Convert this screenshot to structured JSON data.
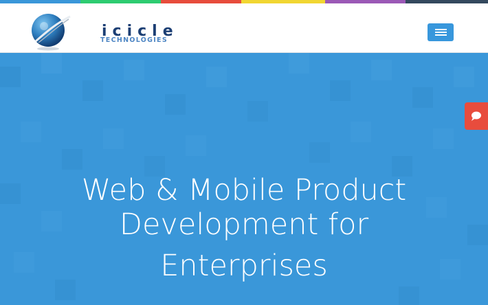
{
  "colorbar": {
    "segments": [
      "#3a97d9",
      "#2ecc71",
      "#e74c3c",
      "#f1d632",
      "#9b59b6",
      "#34495e"
    ]
  },
  "header": {
    "logo": {
      "name": "icicle",
      "tagline": "TECHNOLOGIES",
      "icon": "globe-swoosh-logo"
    },
    "menu_button": {
      "icon": "hamburger-menu-icon"
    }
  },
  "hero": {
    "title_lines": [
      "Web & Mobile Product",
      "Development for",
      "Enterprises"
    ],
    "background": "#3a97d9"
  },
  "side_tab": {
    "icon": "chat-bubble-icon",
    "color": "#e84c3d"
  }
}
